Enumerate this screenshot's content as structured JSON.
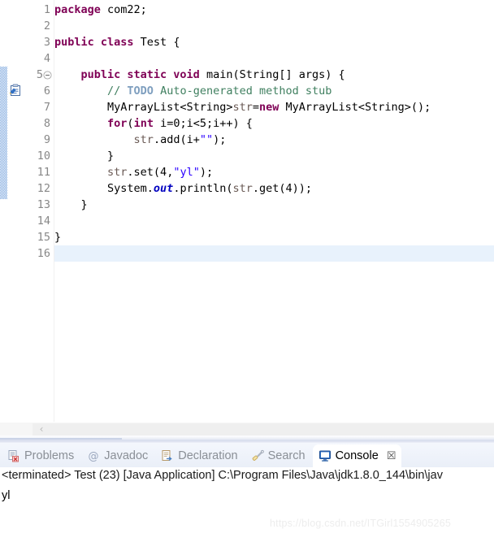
{
  "editor": {
    "language": "java",
    "line_count": 16,
    "current_line": 16,
    "change_bar_lines": [
      5,
      6,
      7,
      8,
      9,
      10,
      11,
      12,
      13
    ],
    "markers": [
      {
        "line": 6,
        "icon": "todo-task-icon",
        "tooltip": "TODO Auto-generated method stub"
      }
    ],
    "fold_markers": [
      {
        "line": 5,
        "icon": "collapse-minus-icon"
      }
    ],
    "line_numbers": [
      "1",
      "2",
      "3",
      "4",
      "5",
      "6",
      "7",
      "8",
      "9",
      "10",
      "11",
      "12",
      "13",
      "14",
      "15",
      "16"
    ],
    "lines": [
      {
        "n": 1,
        "tokens": [
          {
            "t": "kw",
            "v": "package"
          },
          {
            "t": "plain",
            "v": " com22;"
          }
        ]
      },
      {
        "n": 2,
        "tokens": []
      },
      {
        "n": 3,
        "tokens": [
          {
            "t": "kw",
            "v": "public class"
          },
          {
            "t": "plain",
            "v": " Test {"
          }
        ]
      },
      {
        "n": 4,
        "tokens": []
      },
      {
        "n": 5,
        "tokens": [
          {
            "t": "plain",
            "v": "    "
          },
          {
            "t": "kw",
            "v": "public static void"
          },
          {
            "t": "plain",
            "v": " main(String[] args) {"
          }
        ]
      },
      {
        "n": 6,
        "tokens": [
          {
            "t": "plain",
            "v": "        "
          },
          {
            "t": "cmt",
            "v": "// "
          },
          {
            "t": "todo",
            "v": "TODO"
          },
          {
            "t": "cmt",
            "v": " Auto-generated method stub"
          }
        ]
      },
      {
        "n": 7,
        "tokens": [
          {
            "t": "plain",
            "v": "        MyArrayList<String>"
          },
          {
            "t": "lvar",
            "v": "str"
          },
          {
            "t": "plain",
            "v": "="
          },
          {
            "t": "kw",
            "v": "new"
          },
          {
            "t": "plain",
            "v": " MyArrayList<String>();"
          }
        ]
      },
      {
        "n": 8,
        "tokens": [
          {
            "t": "plain",
            "v": "        "
          },
          {
            "t": "kw",
            "v": "for"
          },
          {
            "t": "plain",
            "v": "("
          },
          {
            "t": "kw",
            "v": "int"
          },
          {
            "t": "plain",
            "v": " i=0;i<5;i++) {"
          }
        ]
      },
      {
        "n": 9,
        "tokens": [
          {
            "t": "plain",
            "v": "            "
          },
          {
            "t": "lvar",
            "v": "str"
          },
          {
            "t": "plain",
            "v": ".add(i+"
          },
          {
            "t": "str",
            "v": "\"\""
          },
          {
            "t": "plain",
            "v": ");"
          }
        ]
      },
      {
        "n": 10,
        "tokens": [
          {
            "t": "plain",
            "v": "        }"
          }
        ]
      },
      {
        "n": 11,
        "tokens": [
          {
            "t": "plain",
            "v": "        "
          },
          {
            "t": "lvar",
            "v": "str"
          },
          {
            "t": "plain",
            "v": ".set(4,"
          },
          {
            "t": "str",
            "v": "\"yl\""
          },
          {
            "t": "plain",
            "v": ");"
          }
        ]
      },
      {
        "n": 12,
        "tokens": [
          {
            "t": "plain",
            "v": "        System."
          },
          {
            "t": "fld",
            "v": "out"
          },
          {
            "t": "plain",
            "v": ".println("
          },
          {
            "t": "lvar",
            "v": "str"
          },
          {
            "t": "plain",
            "v": ".get(4));"
          }
        ]
      },
      {
        "n": 13,
        "tokens": [
          {
            "t": "plain",
            "v": "    }"
          }
        ]
      },
      {
        "n": 14,
        "tokens": []
      },
      {
        "n": 15,
        "tokens": [
          {
            "t": "plain",
            "v": "}"
          }
        ]
      },
      {
        "n": 16,
        "tokens": []
      }
    ],
    "horizontal_scrollbar": {
      "left_arrow": "‹"
    }
  },
  "bottom_panel": {
    "tabs": [
      {
        "label": "Problems",
        "icon": "problems-icon",
        "active": false,
        "closable": false
      },
      {
        "label": "Javadoc",
        "icon": "javadoc-at-icon",
        "active": false,
        "closable": false
      },
      {
        "label": "Declaration",
        "icon": "declaration-icon",
        "active": false,
        "closable": false
      },
      {
        "label": "Search",
        "icon": "search-icon",
        "active": false,
        "closable": false
      },
      {
        "label": "Console",
        "icon": "console-icon",
        "active": true,
        "closable": true
      }
    ],
    "close_glyph": "☒",
    "console": {
      "header": "<terminated> Test (23) [Java Application] C:\\Program Files\\Java\\jdk1.8.0_144\\bin\\jav",
      "output": "yl"
    }
  },
  "watermark": {
    "text": "https://blog.csdn.net/ITGirl1554905265"
  },
  "colors": {
    "keyword": "#7F0055",
    "string": "#2A00FF",
    "comment": "#3F7F5F",
    "todo_tag": "#7F9FBF",
    "static_field": "#0000C0",
    "local_var": "#6A5A55",
    "current_line_highlight": "#E8F2FC",
    "change_bar": "#7AA5DD",
    "active_tab_bg": "#FFFFFF"
  }
}
